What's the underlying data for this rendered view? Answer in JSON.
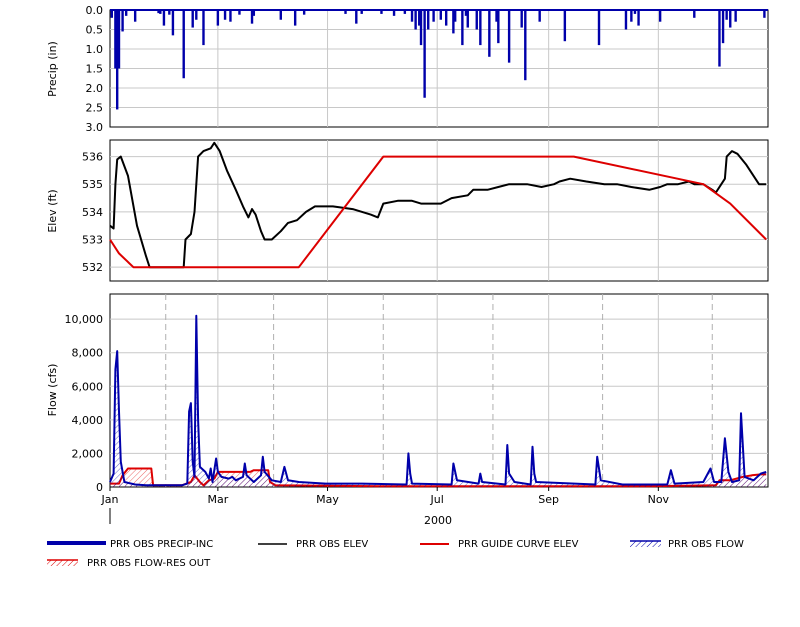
{
  "chart_data": [
    {
      "type": "bar",
      "ylabel": "Precip (in)",
      "ylim": [
        0,
        3.0
      ],
      "y_inverted": true,
      "yticks": [
        "0.0",
        "0.5",
        "1.0",
        "1.5",
        "2.0",
        "2.5",
        "3.0"
      ],
      "grid": true,
      "series": [
        {
          "name": "PRR OBS PRECIP-INC",
          "color": "#0000aa",
          "x_day": [
            1,
            3,
            4,
            5,
            7,
            9,
            14,
            27,
            28,
            30,
            33,
            35,
            41,
            46,
            48,
            52,
            60,
            64,
            67,
            72,
            79,
            80,
            95,
            103,
            108,
            131,
            137,
            140,
            151,
            158,
            164,
            168,
            170,
            172,
            173,
            175,
            177,
            180,
            184,
            187,
            191,
            192,
            196,
            198,
            199,
            204,
            206,
            211,
            215,
            216,
            222,
            229,
            231,
            239,
            253,
            272,
            287,
            290,
            292,
            294,
            306,
            325,
            339,
            341,
            343,
            345,
            348,
            364
          ],
          "values": [
            0.2,
            1.5,
            2.55,
            1.5,
            0.55,
            0.15,
            0.3,
            0.08,
            0.1,
            0.4,
            0.12,
            0.65,
            1.75,
            0.45,
            0.25,
            0.9,
            0.4,
            0.25,
            0.3,
            0.12,
            0.35,
            0.15,
            0.25,
            0.4,
            0.12,
            0.1,
            0.35,
            0.1,
            0.1,
            0.15,
            0.1,
            0.3,
            0.5,
            0.4,
            0.9,
            2.25,
            0.5,
            0.3,
            0.25,
            0.4,
            0.6,
            0.3,
            0.9,
            0.15,
            0.45,
            0.5,
            0.9,
            1.2,
            0.3,
            0.85,
            1.35,
            0.45,
            1.8,
            0.3,
            0.8,
            0.9,
            0.5,
            0.3,
            0.1,
            0.4,
            0.3,
            0.2,
            1.45,
            0.85,
            0.25,
            0.45,
            0.3,
            0.2
          ]
        }
      ]
    },
    {
      "type": "line",
      "ylabel": "Elev (ft)",
      "ylim": [
        531.5,
        536.6
      ],
      "yticks": [
        "532",
        "533",
        "534",
        "535",
        "536"
      ],
      "grid": true,
      "series": [
        {
          "name": "PRR OBS ELEV",
          "color": "#000000",
          "points": [
            [
              0,
              533.5
            ],
            [
              2,
              533.4
            ],
            [
              3,
              535.0
            ],
            [
              4,
              535.9
            ],
            [
              6,
              536.0
            ],
            [
              10,
              535.3
            ],
            [
              15,
              533.5
            ],
            [
              20,
              532.4
            ],
            [
              22,
              532.0
            ],
            [
              30,
              532.0
            ],
            [
              38,
              532.0
            ],
            [
              41,
              532.0
            ],
            [
              42,
              533.0
            ],
            [
              45,
              533.2
            ],
            [
              47,
              534.0
            ],
            [
              49,
              536.0
            ],
            [
              52,
              536.2
            ],
            [
              56,
              536.3
            ],
            [
              58,
              536.5
            ],
            [
              61,
              536.2
            ],
            [
              65,
              535.5
            ],
            [
              70,
              534.8
            ],
            [
              74,
              534.2
            ],
            [
              77,
              533.8
            ],
            [
              79,
              534.1
            ],
            [
              81,
              533.9
            ],
            [
              84,
              533.3
            ],
            [
              86,
              533.0
            ],
            [
              90,
              533.0
            ],
            [
              95,
              533.3
            ],
            [
              99,
              533.6
            ],
            [
              104,
              533.7
            ],
            [
              109,
              534.0
            ],
            [
              114,
              534.2
            ],
            [
              124,
              534.2
            ],
            [
              135,
              534.1
            ],
            [
              145,
              533.9
            ],
            [
              149,
              533.8
            ],
            [
              152,
              534.3
            ],
            [
              160,
              534.4
            ],
            [
              168,
              534.4
            ],
            [
              173,
              534.3
            ],
            [
              178,
              534.3
            ],
            [
              184,
              534.3
            ],
            [
              190,
              534.5
            ],
            [
              199,
              534.6
            ],
            [
              202,
              534.8
            ],
            [
              210,
              534.8
            ],
            [
              216,
              534.9
            ],
            [
              222,
              535.0
            ],
            [
              232,
              535.0
            ],
            [
              240,
              534.9
            ],
            [
              247,
              535.0
            ],
            [
              250,
              535.1
            ],
            [
              256,
              535.2
            ],
            [
              265,
              535.1
            ],
            [
              275,
              535.0
            ],
            [
              282,
              535.0
            ],
            [
              290,
              534.9
            ],
            [
              300,
              534.8
            ],
            [
              306,
              534.9
            ],
            [
              310,
              535.0
            ],
            [
              316,
              535.0
            ],
            [
              322,
              535.1
            ],
            [
              325,
              535.0
            ],
            [
              330,
              535.0
            ],
            [
              335,
              534.8
            ],
            [
              337,
              534.7
            ],
            [
              340,
              535.0
            ],
            [
              342,
              535.2
            ],
            [
              343,
              536.0
            ],
            [
              346,
              536.2
            ],
            [
              349,
              536.1
            ],
            [
              354,
              535.7
            ],
            [
              358,
              535.3
            ],
            [
              361,
              535.0
            ],
            [
              365,
              535.0
            ]
          ]
        },
        {
          "name": "PRR GUIDE CURVE ELEV",
          "color": "#dd0000",
          "points": [
            [
              0,
              533.0
            ],
            [
              5,
              532.5
            ],
            [
              13,
              532.0
            ],
            [
              105,
              532.0
            ],
            [
              152,
              536.0
            ],
            [
              258,
              536.0
            ],
            [
              330,
              535.0
            ],
            [
              345,
              534.3
            ],
            [
              365,
              533.0
            ]
          ]
        }
      ]
    },
    {
      "type": "line",
      "ylabel": "Flow (cfs)",
      "ylim": [
        0,
        11500
      ],
      "yticks": [
        "0",
        "2,000",
        "4,000",
        "6,000",
        "8,000",
        "10,000"
      ],
      "xticks": [
        "Jan",
        "Mar",
        "May",
        "Jul",
        "Sep",
        "Nov"
      ],
      "xticks_day": [
        0,
        60,
        121,
        182,
        244,
        305
      ],
      "xlabel": "2000",
      "grid": true,
      "series": [
        {
          "name": "PRR OBS FLOW",
          "color": "#0000aa",
          "points": [
            [
              0,
              300
            ],
            [
              2,
              800
            ],
            [
              3,
              7000
            ],
            [
              4,
              8100
            ],
            [
              5,
              4500
            ],
            [
              6,
              1500
            ],
            [
              8,
              300
            ],
            [
              14,
              150
            ],
            [
              20,
              100
            ],
            [
              40,
              100
            ],
            [
              43,
              200
            ],
            [
              44,
              4500
            ],
            [
              45,
              5000
            ],
            [
              46,
              1500
            ],
            [
              47,
              600
            ],
            [
              48,
              10200
            ],
            [
              49,
              4000
            ],
            [
              50,
              1200
            ],
            [
              53,
              900
            ],
            [
              55,
              500
            ],
            [
              56,
              1100
            ],
            [
              57,
              300
            ],
            [
              59,
              1700
            ],
            [
              60,
              900
            ],
            [
              62,
              600
            ],
            [
              66,
              500
            ],
            [
              68,
              600
            ],
            [
              70,
              400
            ],
            [
              74,
              600
            ],
            [
              75,
              1400
            ],
            [
              76,
              700
            ],
            [
              80,
              300
            ],
            [
              84,
              700
            ],
            [
              85,
              1800
            ],
            [
              86,
              900
            ],
            [
              90,
              400
            ],
            [
              95,
              300
            ],
            [
              97,
              1200
            ],
            [
              99,
              400
            ],
            [
              105,
              300
            ],
            [
              120,
              200
            ],
            [
              140,
              200
            ],
            [
              165,
              150
            ],
            [
              166,
              2000
            ],
            [
              167,
              800
            ],
            [
              168,
              200
            ],
            [
              190,
              150
            ],
            [
              191,
              1400
            ],
            [
              193,
              400
            ],
            [
              205,
              200
            ],
            [
              206,
              800
            ],
            [
              207,
              300
            ],
            [
              220,
              150
            ],
            [
              221,
              2500
            ],
            [
              222,
              800
            ],
            [
              225,
              300
            ],
            [
              234,
              150
            ],
            [
              235,
              2400
            ],
            [
              236,
              800
            ],
            [
              237,
              300
            ],
            [
              270,
              150
            ],
            [
              271,
              1800
            ],
            [
              273,
              400
            ],
            [
              285,
              150
            ],
            [
              310,
              150
            ],
            [
              312,
              1000
            ],
            [
              314,
              200
            ],
            [
              330,
              300
            ],
            [
              334,
              1100
            ],
            [
              336,
              300
            ],
            [
              340,
              300
            ],
            [
              342,
              2900
            ],
            [
              344,
              900
            ],
            [
              346,
              300
            ],
            [
              350,
              400
            ],
            [
              351,
              4400
            ],
            [
              352,
              2500
            ],
            [
              353,
              600
            ],
            [
              358,
              400
            ],
            [
              362,
              800
            ],
            [
              365,
              900
            ]
          ]
        },
        {
          "name": "PRR OBS FLOW-RES OUT",
          "color": "#dd0000",
          "points": [
            [
              0,
              200
            ],
            [
              5,
              200
            ],
            [
              7,
              700
            ],
            [
              10,
              1100
            ],
            [
              23,
              1100
            ],
            [
              24,
              100
            ],
            [
              40,
              100
            ],
            [
              45,
              300
            ],
            [
              47,
              700
            ],
            [
              50,
              300
            ],
            [
              52,
              100
            ],
            [
              55,
              400
            ],
            [
              58,
              500
            ],
            [
              60,
              900
            ],
            [
              78,
              900
            ],
            [
              80,
              1000
            ],
            [
              88,
              1000
            ],
            [
              89,
              300
            ],
            [
              92,
              100
            ],
            [
              150,
              50
            ],
            [
              300,
              50
            ],
            [
              337,
              100
            ],
            [
              339,
              400
            ],
            [
              345,
              400
            ],
            [
              352,
              600
            ],
            [
              357,
              700
            ],
            [
              362,
              750
            ],
            [
              365,
              750
            ]
          ]
        }
      ]
    }
  ],
  "legend": [
    {
      "name": "PRR OBS PRECIP-INC",
      "swatch": "thick-line",
      "color": "#0000aa"
    },
    {
      "name": "PRR OBS ELEV",
      "swatch": "line",
      "color": "#000000"
    },
    {
      "name": "PRR GUIDE CURVE ELEV",
      "swatch": "line",
      "color": "#dd0000"
    },
    {
      "name": "PRR OBS FLOW",
      "swatch": "hatch",
      "color": "#0000aa"
    },
    {
      "name": "PRR OBS FLOW-RES OUT",
      "swatch": "hatch",
      "color": "#dd0000"
    }
  ]
}
